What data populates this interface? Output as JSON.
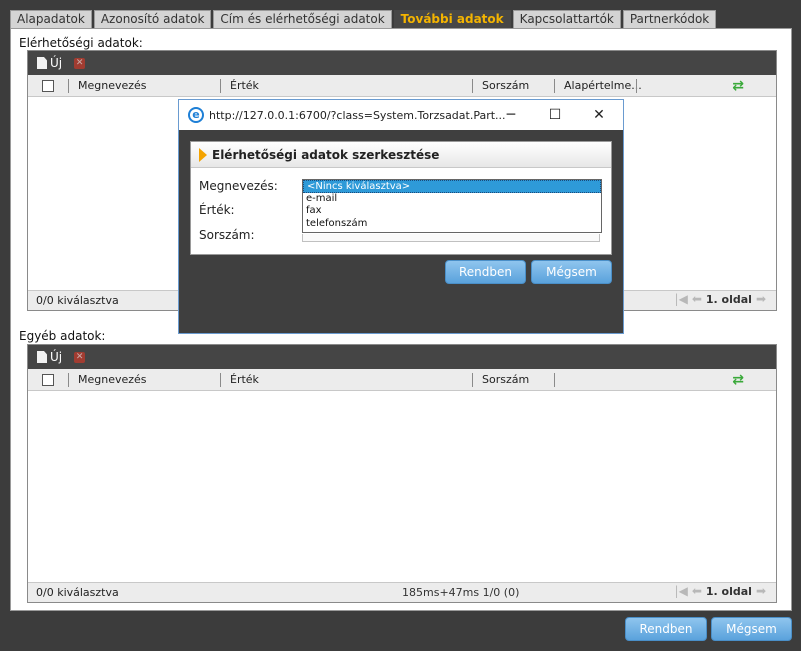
{
  "tabs": [
    {
      "label": "Alapadatok",
      "active": false
    },
    {
      "label": "Azonosító adatok",
      "active": false
    },
    {
      "label": "Cím és elérhetőségi adatok",
      "active": false
    },
    {
      "label": "További adatok",
      "active": true
    },
    {
      "label": "Kapcsolattartók",
      "active": false
    },
    {
      "label": "Partnerkódok",
      "active": false
    }
  ],
  "contact_section": {
    "title": "Elérhetőségi adatok:",
    "new_label": "Új",
    "columns": {
      "name": "Megnevezés",
      "value": "Érték",
      "order": "Sorszám",
      "default": "Alapértelme..."
    },
    "footer": {
      "selected": "0/0 kiválasztva",
      "page": "1. oldal"
    }
  },
  "other_section": {
    "title": "Egyéb adatok:",
    "new_label": "Új",
    "columns": {
      "name": "Megnevezés",
      "value": "Érték",
      "order": "Sorszám"
    },
    "footer": {
      "selected": "0/0 kiválasztva",
      "timing": "185ms+47ms 1/0 (0)",
      "page": "1. oldal"
    }
  },
  "main_buttons": {
    "ok": "Rendben",
    "cancel": "Mégsem"
  },
  "dialog": {
    "url": "http://127.0.0.1:6700/?class=System.Torzsadat.Part...",
    "form_title": "Elérhetőségi adatok szerkesztése",
    "labels": {
      "name": "Megnevezés:",
      "value": "Érték:",
      "order": "Sorszám:"
    },
    "name_options": [
      "<Nincs kiválasztva>",
      "e-mail",
      "fax",
      "telefonszám"
    ],
    "selected_option": "<Nincs kiválasztva>",
    "buttons": {
      "ok": "Rendben",
      "cancel": "Mégsem"
    }
  },
  "colors": {
    "accent_tab": "#f4b400",
    "button": "#5aa2dc",
    "toolbar": "#454545"
  }
}
